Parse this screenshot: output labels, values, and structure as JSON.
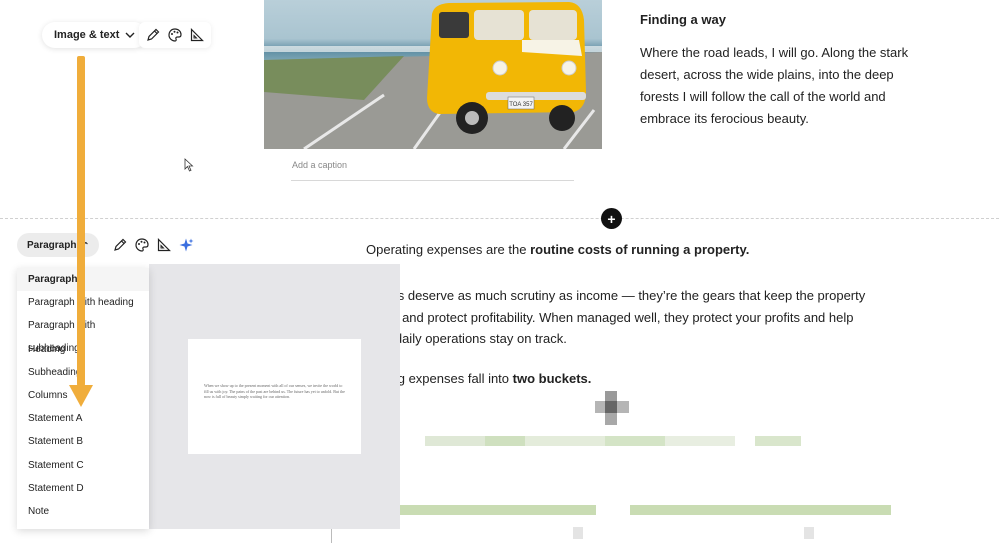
{
  "top_toolbar": {
    "block_type_label": "Image & text",
    "icons": [
      "pencil-icon",
      "palette-icon",
      "set-square-icon"
    ]
  },
  "image_block": {
    "caption_placeholder": "Add a caption",
    "plate_text": "TOA 357"
  },
  "text_block": {
    "heading": "Finding a way",
    "body": "Where the road leads, I will go. Along the stark desert, across the wide plains, into the deep forests I will follow the call of the world and embrace its ferocious beauty."
  },
  "second_toolbar": {
    "block_type_label": "Paragraph",
    "icons": [
      "pencil-icon",
      "palette-icon",
      "set-square-icon",
      "sparkle-icon"
    ]
  },
  "dropdown": {
    "selected": "Paragraph",
    "items": [
      "Paragraph",
      "Paragraph with heading",
      "Paragraph with subheading",
      "Heading",
      "Subheading",
      "Columns",
      "Statement A",
      "Statement B",
      "Statement C",
      "Statement D",
      "Note"
    ]
  },
  "preview": {
    "text": "When we show up to the present moment with all of our senses, we invite the world to fill us with joy. The pains of the past are behind us. The future has yet to unfold. But the now is full of beauty simply waiting for our attention."
  },
  "content": {
    "p1_normal": "Operating expenses are the ",
    "p1_bold": "routine costs of running a property.",
    "p2_line1": "ses deserve as much scrutiny as income — they’re the gears that keep the property",
    "p2_line2": "ng and protect profitability. When managed well, they protect your profits and help",
    "p2_line3": "e daily operations stay on track.",
    "p3_normal": "ting expenses fall into ",
    "p3_bold": "two buckets."
  },
  "colors": {
    "annotation_arrow": "#f0ad3b",
    "sparkle": "#3b6fe0",
    "van": "#f2b705"
  }
}
